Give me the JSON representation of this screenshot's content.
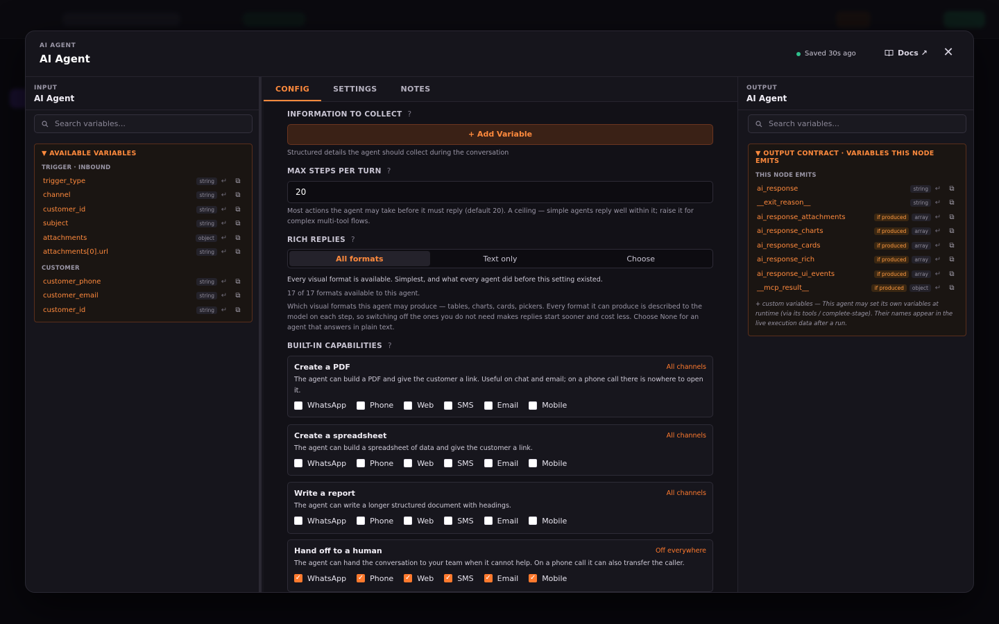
{
  "modal": {
    "eyebrow": "AI AGENT",
    "title": "AI Agent",
    "saved_text": "Saved 30s ago",
    "docs_label": "Docs ↗",
    "close_icon": "close-icon"
  },
  "input_panel": {
    "eyebrow": "INPUT",
    "title": "AI Agent",
    "search_placeholder": "Search variables...",
    "box_title": "▼ AVAILABLE VARIABLES",
    "groups": [
      {
        "label": "TRIGGER · INBOUND",
        "items": [
          {
            "name": "trigger_type",
            "type": "string"
          },
          {
            "name": "channel",
            "type": "string"
          },
          {
            "name": "customer_id",
            "type": "string"
          },
          {
            "name": "subject",
            "type": "string"
          },
          {
            "name": "attachments",
            "type": "object"
          },
          {
            "name": "attachments[0].url",
            "type": "string"
          }
        ]
      },
      {
        "label": "CUSTOMER",
        "items": [
          {
            "name": "customer_phone",
            "type": "string"
          },
          {
            "name": "customer_email",
            "type": "string"
          },
          {
            "name": "customer_id",
            "type": "string"
          }
        ]
      }
    ]
  },
  "config": {
    "tabs": [
      "CONFIG",
      "SETTINGS",
      "NOTES"
    ],
    "info_label": "INFORMATION TO COLLECT",
    "add_variable": "+ Add Variable",
    "info_help": "Structured details the agent should collect during the conversation",
    "max_steps_label": "MAX STEPS PER TURN",
    "max_steps_value": "20",
    "max_steps_help": "Most actions the agent may take before it must reply (default 20). A ceiling — simple agents reply well within it; raise it for complex multi-tool flows.",
    "rich_label": "RICH REPLIES",
    "rich_options": [
      "All formats",
      "Text only",
      "Choose"
    ],
    "rich_selected": "All formats",
    "rich_desc": "Every visual format is available. Simplest, and what every agent did before this setting existed.",
    "rich_count": "17 of 17 formats available to this agent.",
    "rich_help": "Which visual formats this agent may produce — tables, charts, cards, pickers. Every format it can produce is described to the model on each step, so switching off the ones you do not need makes replies start sooner and cost less. Choose None for an agent that answers in plain text.",
    "cap_label": "BUILT-IN CAPABILITIES",
    "channels": [
      "WhatsApp",
      "Phone",
      "Web",
      "SMS",
      "Email",
      "Mobile"
    ],
    "capabilities": [
      {
        "title": "Create a PDF",
        "tag": "All channels",
        "desc": "The agent can build a PDF and give the customer a link. Useful on chat and email; on a phone call there is nowhere to open it.",
        "checked": false
      },
      {
        "title": "Create a spreadsheet",
        "tag": "All channels",
        "desc": "The agent can build a spreadsheet of data and give the customer a link.",
        "checked": false
      },
      {
        "title": "Write a report",
        "tag": "All channels",
        "desc": "The agent can write a longer structured document with headings.",
        "checked": false
      },
      {
        "title": "Hand off to a human",
        "tag": "Off everywhere",
        "desc": "The agent can hand the conversation to your team when it cannot help. On a phone call it can also transfer the caller.",
        "checked": true
      }
    ]
  },
  "output_panel": {
    "eyebrow": "OUTPUT",
    "title": "AI Agent",
    "search_placeholder": "Search variables...",
    "box_title": "▼ OUTPUT CONTRACT · VARIABLES THIS NODE EMITS",
    "group_label": "THIS NODE EMITS",
    "items": [
      {
        "name": "ai_response",
        "flag": "",
        "type": "string"
      },
      {
        "name": "__exit_reason__",
        "flag": "",
        "type": "string"
      },
      {
        "name": "ai_response_attachments",
        "flag": "if produced",
        "type": "array"
      },
      {
        "name": "ai_response_charts",
        "flag": "if produced",
        "type": "array"
      },
      {
        "name": "ai_response_cards",
        "flag": "if produced",
        "type": "array"
      },
      {
        "name": "ai_response_rich",
        "flag": "if produced",
        "type": "array"
      },
      {
        "name": "ai_response_ui_events",
        "flag": "if produced",
        "type": "array"
      },
      {
        "name": "__mcp_result__",
        "flag": "if produced",
        "type": "object"
      }
    ],
    "note": "+ custom variables — This agent may set its own variables at runtime (via its tools / complete-stage). Their names appear in the live execution data after a run."
  },
  "colors": {
    "accent": "#ff8a3d",
    "status_ok": "#2fbf8c",
    "bg": "#16151c"
  }
}
